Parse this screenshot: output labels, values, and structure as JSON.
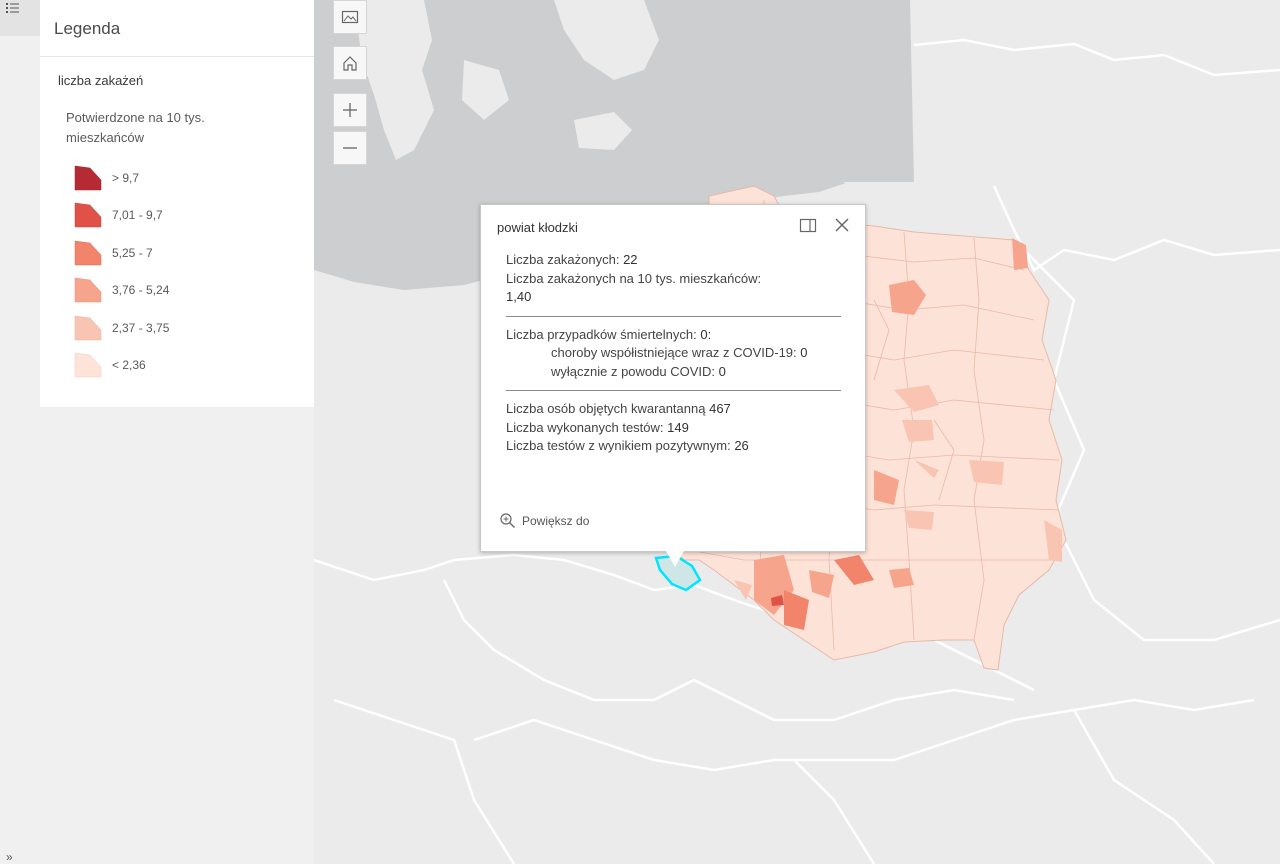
{
  "colors": {
    "water": "#cfd0d1",
    "land": "#ebebeb",
    "border": "#ffffff",
    "class_1": "#b52b33",
    "class_2": "#e05248",
    "class_3": "#f1846b",
    "class_4": "#f6a58c",
    "class_5": "#f9c5b2",
    "class_6": "#fde3d8",
    "highlight": "#00e5ff"
  },
  "icons": {
    "legend_toggle": "legend-list-icon",
    "basemap": "basemap-gallery-icon",
    "home": "home-icon",
    "zoom_in": "plus-icon",
    "zoom_out": "minus-icon",
    "dock": "dock-icon",
    "close": "close-icon",
    "zoom_to": "magnifier-plus-icon",
    "expand": "double-chevron-right-icon"
  },
  "sidebar": {
    "expand_label": "»"
  },
  "legend": {
    "title": "Legenda",
    "layer_name": "liczba zakażeń",
    "field_label": "Potwierdzone na 10 tys. mieszkańców",
    "classes": [
      {
        "label": "> 9,7",
        "color": "#b52b33"
      },
      {
        "label": "7,01 - 9,7",
        "color": "#e05248"
      },
      {
        "label": "5,25 - 7",
        "color": "#f1846b"
      },
      {
        "label": "3,76 - 5,24",
        "color": "#f6a58c"
      },
      {
        "label": "2,37 - 3,75",
        "color": "#f9c5b2"
      },
      {
        "label": "< 2,36",
        "color": "#fde3d8"
      }
    ]
  },
  "popup": {
    "title": "powiat kłodzki",
    "cases_label": "Liczba zakażonych:",
    "cases_value": "22",
    "cases_per10k_label": "Liczba zakażonych na 10 tys. mieszkańców:",
    "cases_per10k_value": "1,40",
    "deaths_label": "Liczba przypadków śmiertelnych:",
    "deaths_value": "0:",
    "comorbid_label": "choroby współistniejące wraz z COVID-19:",
    "comorbid_value": "0",
    "covid_only_label": "wyłącznie z powodu COVID:",
    "covid_only_value": "0",
    "quarantine_label": "Liczba osób objętych kwarantanną",
    "quarantine_value": "467",
    "tests_label": "Liczba wykonanych testów:",
    "tests_value": "149",
    "positive_label": "Liczba testów z wynikiem pozytywnym:",
    "positive_value": "26",
    "zoom_label": "Powiększ do"
  }
}
